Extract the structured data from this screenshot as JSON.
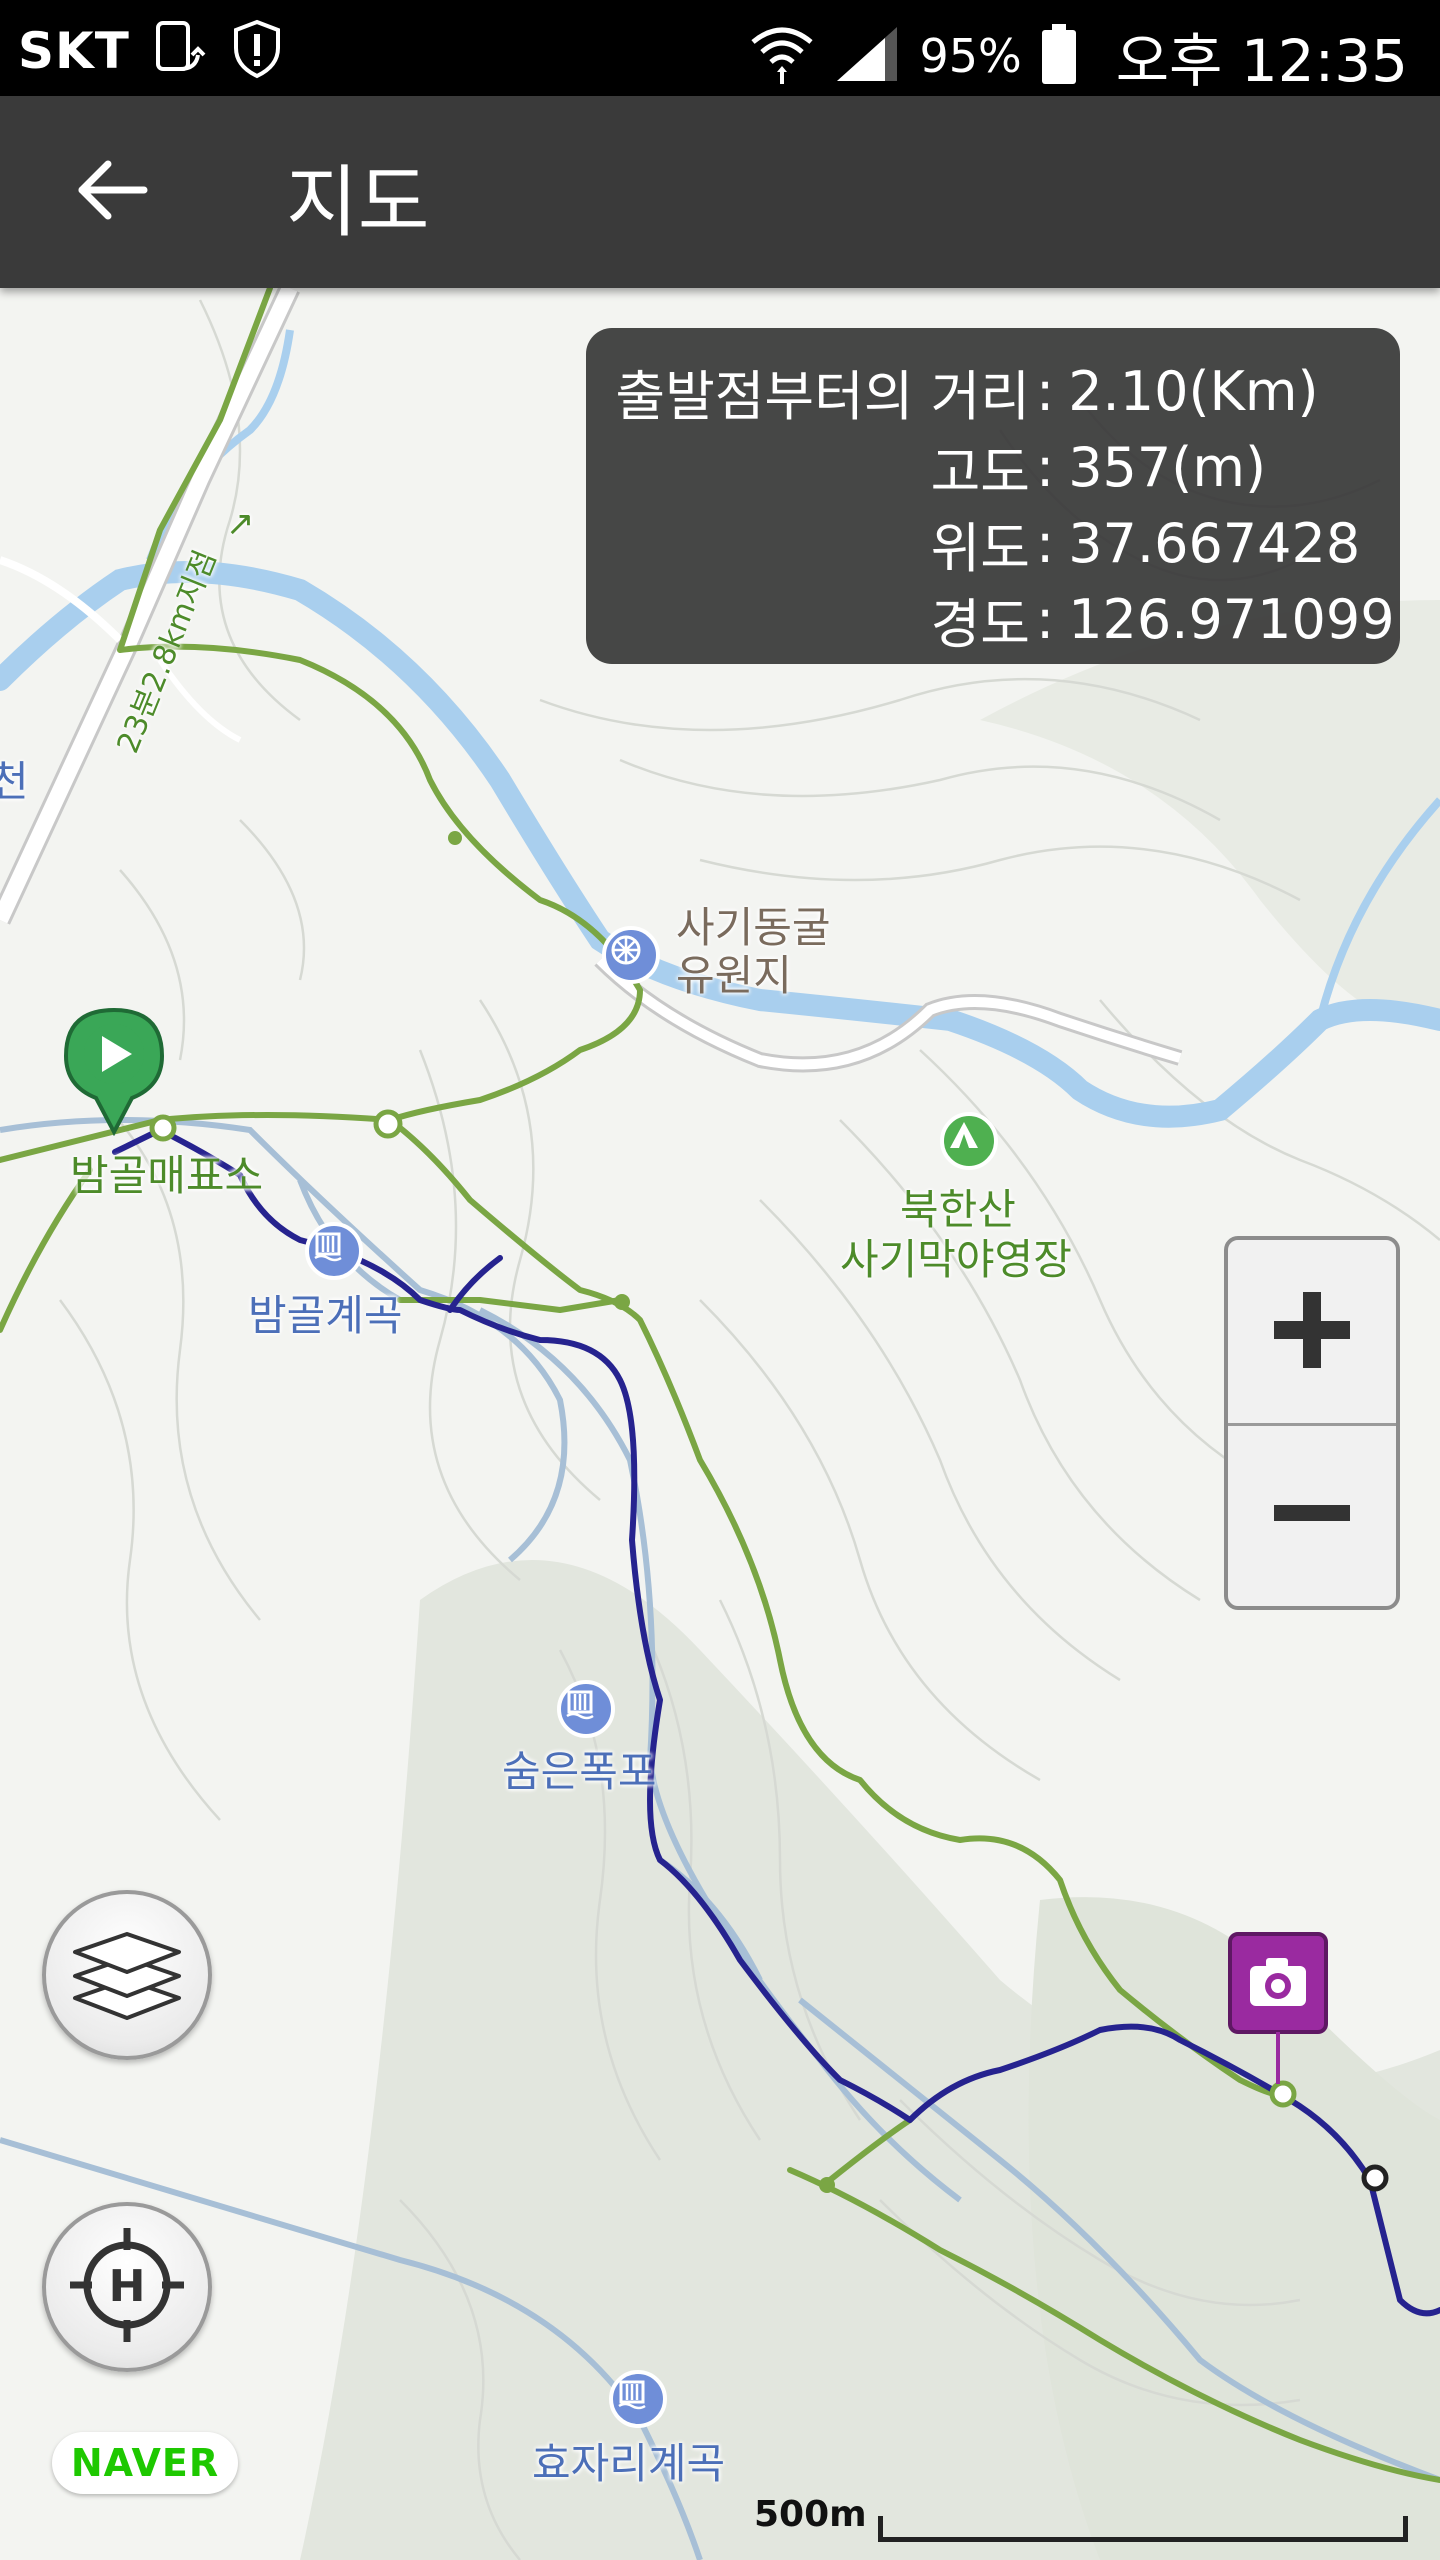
{
  "status_bar": {
    "carrier": "SKT",
    "battery_percent": "95%",
    "time": "오후 12:35",
    "icons": [
      "device-sync-icon",
      "alert-shield-icon",
      "wifi-icon",
      "signal-icon",
      "battery-icon"
    ]
  },
  "app_bar": {
    "title": "지도",
    "back_icon": "arrow-left-icon"
  },
  "info_panel": {
    "rows": [
      {
        "label": "출발점부터의 거리",
        "value": "2.10(Km)"
      },
      {
        "label": "고도",
        "value": "357(m)"
      },
      {
        "label": "위도",
        "value": "37.667428"
      },
      {
        "label": "경도",
        "value": "126.971099"
      }
    ]
  },
  "map_labels": {
    "sagi_cave": "사기동굴\n유원지",
    "bukhansan_camp_line1": "북한산",
    "bukhansan_camp_line2": "사기막야영장",
    "bamgol_ticket": "밤골매표소",
    "bamgol_valley": "밤골계곡",
    "hidden_falls": "숨은폭포",
    "hyojari_valley": "효자리계곡",
    "road_label": "23분2.8km지점",
    "edge_fragment": "천",
    "road_arrow": "↗"
  },
  "controls": {
    "zoom_in_icon": "plus-icon",
    "zoom_out_icon": "minus-icon",
    "layers_icon": "layers-icon",
    "location_icon": "crosshair-h-icon"
  },
  "map_footer": {
    "provider": "NAVER",
    "scale_label": "500m"
  },
  "colors": {
    "track_blue": "#26238f",
    "trail_green": "#7aa644",
    "water": "#a9cfee",
    "start_marker": "#3aa757",
    "camera_marker": "#9a2aa0"
  }
}
